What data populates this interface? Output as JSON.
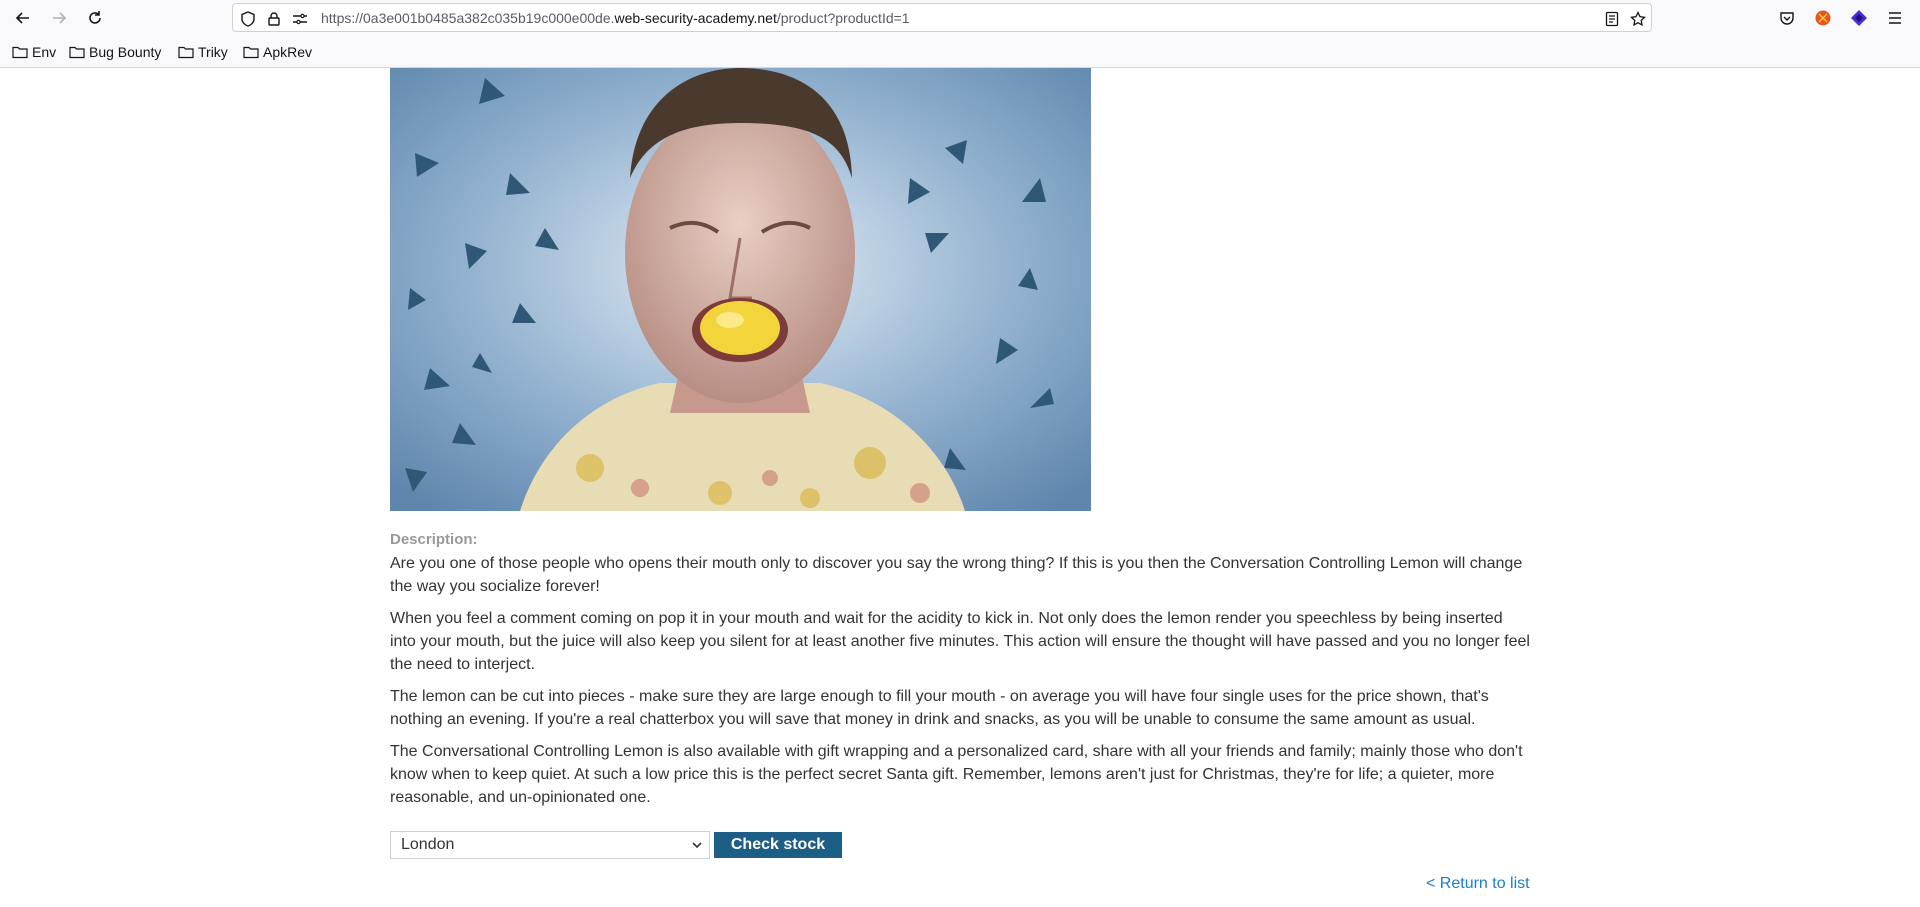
{
  "browser": {
    "url_prefix": "https://0a3e001b0485a382c035b19c000e00de.",
    "url_domain": "web-security-academy.net",
    "url_path": "/product?productId=1",
    "bookmarks": [
      {
        "label": "Env"
      },
      {
        "label": "Bug Bounty"
      },
      {
        "label": "Triky"
      },
      {
        "label": "ApkRev"
      }
    ]
  },
  "product": {
    "description_label": "Description:",
    "paragraphs": [
      "Are you one of those people who opens their mouth only to discover you say the wrong thing? If this is you then the Conversation Controlling Lemon will change the way you socialize forever!",
      "When you feel a comment coming on pop it in your mouth and wait for the acidity to kick in. Not only does the lemon render you speechless by being inserted into your mouth, but the juice will also keep you silent for at least another five minutes. This action will ensure the thought will have passed and you no longer feel the need to interject.",
      "The lemon can be cut into pieces - make sure they are large enough to fill your mouth - on average you will have four single uses for the price shown, that's nothing an evening. If you're a real chatterbox you will save that money in drink and snacks, as you will be unable to consume the same amount as usual.",
      "The Conversational Controlling Lemon is also available with gift wrapping and a personalized card, share with all your friends and family; mainly those who don't know when to keep quiet. At such a low price this is the perfect secret Santa gift. Remember, lemons aren't just for Christmas, they're for life; a quieter, more reasonable, and un-opinionated one."
    ],
    "store_selected": "London",
    "check_stock_label": "Check stock",
    "return_link": "< Return to list"
  },
  "colors": {
    "button": "#1d5e86",
    "link": "#1d7fc4",
    "label": "#999999"
  }
}
